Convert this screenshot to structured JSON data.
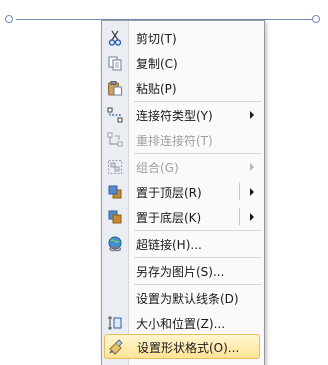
{
  "menu": {
    "items": [
      {
        "label": "剪切(T)",
        "icon": "scissors-icon",
        "enabled": true
      },
      {
        "label": "复制(C)",
        "icon": "copy-icon",
        "enabled": true
      },
      {
        "label": "粘贴(P)",
        "icon": "paste-icon",
        "enabled": true
      },
      {
        "label": "连接符类型(Y)",
        "icon": "connector-type-icon",
        "enabled": true,
        "submenu": true
      },
      {
        "label": "重排连接符(T)",
        "icon": "reroute-connector-icon",
        "enabled": false
      },
      {
        "label": "组合(G)",
        "icon": "group-icon",
        "enabled": false,
        "submenu": true
      },
      {
        "label": "置于顶层(R)",
        "icon": "bring-to-front-icon",
        "enabled": true,
        "submenu": true
      },
      {
        "label": "置于底层(K)",
        "icon": "send-to-back-icon",
        "enabled": true,
        "submenu": true
      },
      {
        "label": "超链接(H)...",
        "icon": "hyperlink-icon",
        "enabled": true
      },
      {
        "label": "另存为图片(S)...",
        "icon": "",
        "enabled": true
      },
      {
        "label": "设置为默认线条(D)",
        "icon": "",
        "enabled": true
      },
      {
        "label": "大小和位置(Z)...",
        "icon": "size-position-icon",
        "enabled": true
      },
      {
        "label": "设置形状格式(O)...",
        "icon": "format-shape-icon",
        "enabled": true,
        "highlighted": true
      }
    ]
  },
  "colors": {
    "connector": "#6f8cc2",
    "highlight_border": "#e8bd5f",
    "highlight_fill": "#ffe497",
    "disabled_text": "#a0a0a0"
  }
}
